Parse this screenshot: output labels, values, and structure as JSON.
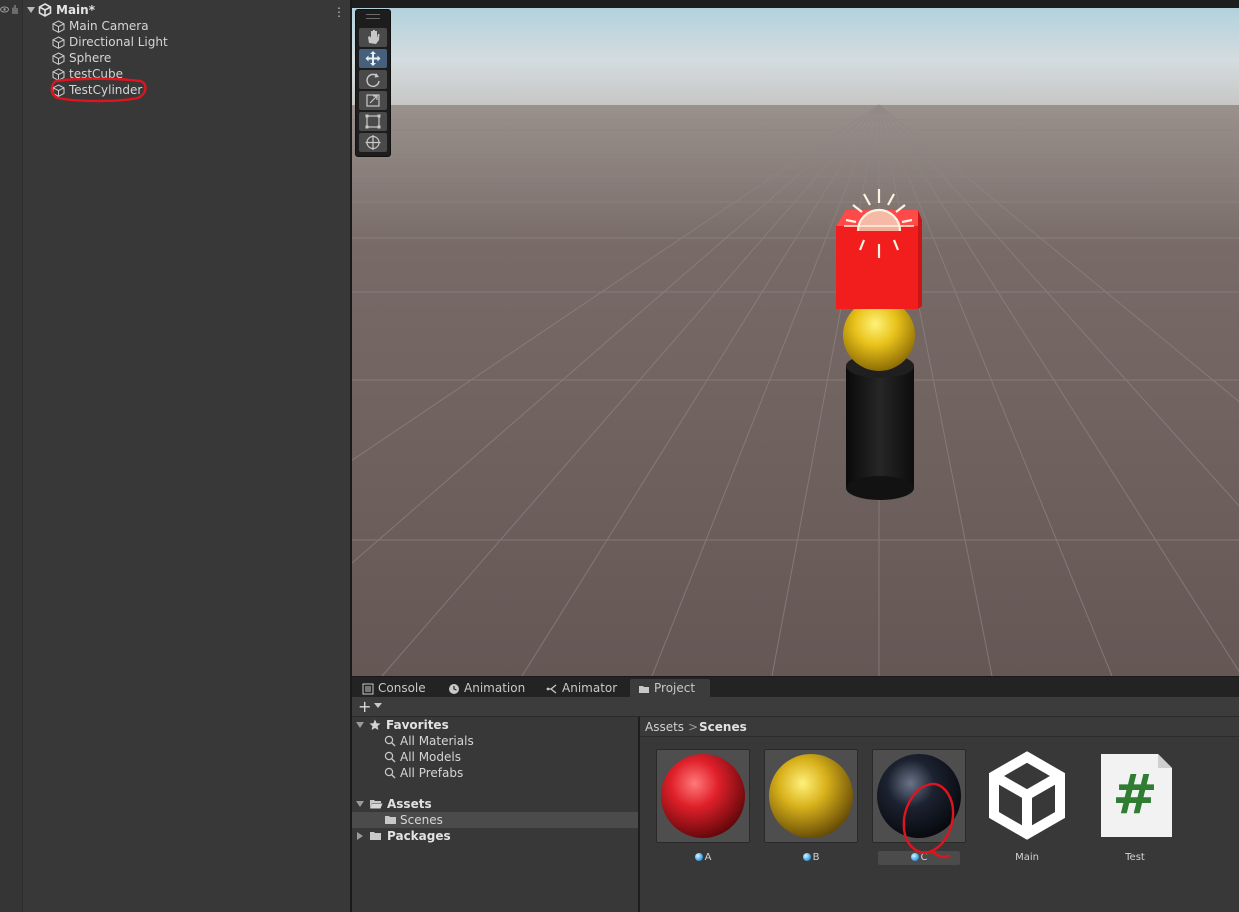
{
  "hierarchy": {
    "scene_name": "Main*",
    "items": [
      {
        "label": "Main Camera"
      },
      {
        "label": "Directional Light"
      },
      {
        "label": "Sphere"
      },
      {
        "label": "testCube"
      },
      {
        "label": "TestCylinder"
      }
    ],
    "menu_glyph": "⋮"
  },
  "scene_view": {
    "tools": [
      "hand-tool",
      "move-tool",
      "rotate-tool",
      "scale-tool",
      "rect-tool",
      "transform-tool"
    ],
    "active_tool": "move-tool",
    "objects": [
      {
        "name": "testCube",
        "color": "#ff2222"
      },
      {
        "name": "Sphere",
        "color": "#e8c21a"
      },
      {
        "name": "TestCylinder",
        "color": "#1a1a1a"
      }
    ]
  },
  "bottom_tabs": [
    {
      "label": "Console",
      "icon": "console-icon"
    },
    {
      "label": "Animation",
      "icon": "animation-icon"
    },
    {
      "label": "Animator",
      "icon": "animator-icon"
    },
    {
      "label": "Project",
      "icon": "folder-icon",
      "active": true
    }
  ],
  "project": {
    "add_label": "+",
    "favorites": {
      "label": "Favorites",
      "items": [
        "All Materials",
        "All Models",
        "All Prefabs"
      ]
    },
    "assets_label": "Assets",
    "scenes_label": "Scenes",
    "packages_label": "Packages",
    "breadcrumb": {
      "root": "Assets",
      "separator": ">",
      "current": "Scenes"
    },
    "assets": [
      {
        "label": "A",
        "type": "material",
        "color": "#e0202a"
      },
      {
        "label": "B",
        "type": "material",
        "color": "#d9b21c"
      },
      {
        "label": "C",
        "type": "material",
        "color": "#1c2230"
      },
      {
        "label": "Main",
        "type": "scene"
      },
      {
        "label": "Test",
        "type": "script",
        "glyph": "#"
      }
    ]
  },
  "colors": {
    "accent": "#46607c",
    "annotation": "#e0141e"
  }
}
